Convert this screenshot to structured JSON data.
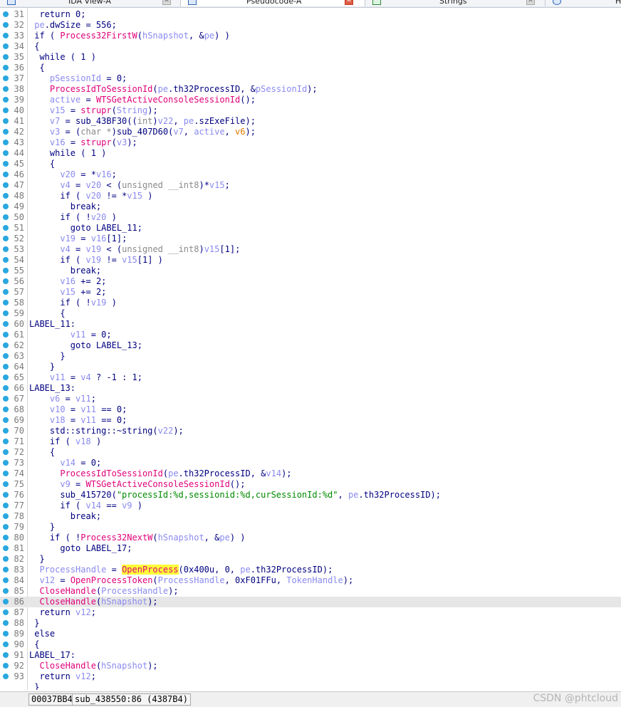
{
  "tabs": [
    {
      "label": "IDA View-A",
      "icon": "ida-view-icon",
      "active": false
    },
    {
      "label": "Pseudocode-A",
      "icon": "pseudocode-icon",
      "active": true
    },
    {
      "label": "Strings",
      "icon": "strings-icon",
      "active": false
    },
    {
      "label": "He",
      "icon": "hex-view-icon",
      "active": false
    }
  ],
  "code_lines": [
    {
      "n": "31",
      "h": "  return 0;"
    },
    {
      "n": "32",
      "h": " <span class=\"v\">pe</span>.dwSize = 556;"
    },
    {
      "n": "33",
      "h": " if ( <span class=\"f\">Process32FirstW</span>(<span class=\"v\">hSnapshot</span>, &amp;<span class=\"v\">pe</span>) )"
    },
    {
      "n": "34",
      "h": " {"
    },
    {
      "n": "35",
      "h": "  while ( 1 )"
    },
    {
      "n": "36",
      "h": "  {"
    },
    {
      "n": "37",
      "h": "    <span class=\"v\">pSessionId</span> = 0;"
    },
    {
      "n": "38",
      "h": "    <span class=\"f\">ProcessIdToSessionId</span>(<span class=\"v\">pe</span>.th32ProcessID, &amp;<span class=\"v\">pSessionId</span>);"
    },
    {
      "n": "39",
      "h": "    <span class=\"v\">active</span> = <span class=\"f\">WTSGetActiveConsoleSessionId</span>();"
    },
    {
      "n": "40",
      "h": "    <span class=\"v\">v15</span> = <span class=\"f\">strupr</span>(<span class=\"v\">String</span>);"
    },
    {
      "n": "41",
      "h": "    <span class=\"v\">v7</span> = sub_43BF30((<span class=\"g\">int</span>)<span class=\"v\">v22</span>, <span class=\"v\">pe</span>.szExeFile);"
    },
    {
      "n": "42",
      "h": "    <span class=\"v\">v3</span> = (<span class=\"g\">char *</span>)sub_407D60(<span class=\"v\">v7</span>, <span class=\"v\">active</span>, <span class=\"o\">v6</span>);"
    },
    {
      "n": "43",
      "h": "    <span class=\"v\">v16</span> = <span class=\"f\">strupr</span>(<span class=\"v\">v3</span>);"
    },
    {
      "n": "44",
      "h": "    while ( 1 )"
    },
    {
      "n": "45",
      "h": "    {"
    },
    {
      "n": "46",
      "h": "      <span class=\"v\">v20</span> = *<span class=\"v\">v16</span>;"
    },
    {
      "n": "47",
      "h": "      <span class=\"v\">v4</span> = <span class=\"v\">v20</span> &lt; (<span class=\"g\">unsigned __int8</span>)*<span class=\"v\">v15</span>;"
    },
    {
      "n": "48",
      "h": "      if ( <span class=\"v\">v20</span> != *<span class=\"v\">v15</span> )"
    },
    {
      "n": "49",
      "h": "        break;"
    },
    {
      "n": "50",
      "h": "      if ( !<span class=\"v\">v20</span> )"
    },
    {
      "n": "51",
      "h": "        goto LABEL_11;"
    },
    {
      "n": "52",
      "h": "      <span class=\"v\">v19</span> = <span class=\"v\">v16</span>[1];"
    },
    {
      "n": "53",
      "h": "      <span class=\"v\">v4</span> = <span class=\"v\">v19</span> &lt; (<span class=\"g\">unsigned __int8</span>)<span class=\"v\">v15</span>[1];"
    },
    {
      "n": "54",
      "h": "      if ( <span class=\"v\">v19</span> != <span class=\"v\">v15</span>[1] )"
    },
    {
      "n": "55",
      "h": "        break;"
    },
    {
      "n": "56",
      "h": "      <span class=\"v\">v16</span> += 2;"
    },
    {
      "n": "57",
      "h": "      <span class=\"v\">v15</span> += 2;"
    },
    {
      "n": "58",
      "h": "      if ( !<span class=\"v\">v19</span> )"
    },
    {
      "n": "59",
      "h": "      {"
    },
    {
      "n": "60",
      "h": "LABEL_11:"
    },
    {
      "n": "61",
      "h": "        <span class=\"v\">v11</span> = 0;"
    },
    {
      "n": "62",
      "h": "        goto LABEL_13;"
    },
    {
      "n": "63",
      "h": "      }"
    },
    {
      "n": "64",
      "h": "    }"
    },
    {
      "n": "65",
      "h": "    <span class=\"v\">v11</span> = <span class=\"v\">v4</span> ? -1 : 1;"
    },
    {
      "n": "66",
      "h": "LABEL_13:"
    },
    {
      "n": "67",
      "h": "    <span class=\"v\">v6</span> = <span class=\"v\">v11</span>;"
    },
    {
      "n": "68",
      "h": "    <span class=\"v\">v10</span> = <span class=\"v\">v11</span> == 0;"
    },
    {
      "n": "69",
      "h": "    <span class=\"v\">v18</span> = <span class=\"v\">v11</span> == 0;"
    },
    {
      "n": "70",
      "h": "    std::string::~string(<span class=\"v\">v22</span>);"
    },
    {
      "n": "71",
      "h": "    if ( <span class=\"v\">v18</span> )"
    },
    {
      "n": "72",
      "h": "    {"
    },
    {
      "n": "73",
      "h": "      <span class=\"v\">v14</span> = 0;"
    },
    {
      "n": "74",
      "h": "      <span class=\"f\">ProcessIdToSessionId</span>(<span class=\"v\">pe</span>.th32ProcessID, &amp;<span class=\"v\">v14</span>);"
    },
    {
      "n": "75",
      "h": "      <span class=\"v\">v9</span> = <span class=\"f\">WTSGetActiveConsoleSessionId</span>();"
    },
    {
      "n": "76",
      "h": "      sub_415720(<span class=\"s\">\"processId:%d,sessionid:%d,curSessionId:%d\"</span>, <span class=\"v\">pe</span>.th32ProcessID);"
    },
    {
      "n": "77",
      "h": "      if ( <span class=\"v\">v14</span> == <span class=\"v\">v9</span> )"
    },
    {
      "n": "78",
      "h": "        break;"
    },
    {
      "n": "79",
      "h": "    }"
    },
    {
      "n": "80",
      "h": "    if ( !<span class=\"f\">Process32NextW</span>(<span class=\"v\">hSnapshot</span>, &amp;<span class=\"v\">pe</span>) )"
    },
    {
      "n": "81",
      "h": "      goto LABEL_17;"
    },
    {
      "n": "82",
      "h": "  }"
    },
    {
      "n": "83",
      "h": "  <span class=\"v\">ProcessHandle</span> = <span class=\"f y\">OpenProcess</span>(0x400u, 0, <span class=\"v\">pe</span>.th32ProcessID);"
    },
    {
      "n": "84",
      "h": "  <span class=\"v\">v12</span> = <span class=\"f\">OpenProcessToken</span>(<span class=\"v\">ProcessHandle</span>, 0xF01FFu, <span class=\"v\">TokenHandle</span>);"
    },
    {
      "n": "85",
      "h": "  <span class=\"f\">CloseHandle</span>(<span class=\"v\">ProcessHandle</span>);"
    },
    {
      "n": "86",
      "h": "  <span class=\"f\">CloseHandle</span>(<span class=\"v\">hSnapshot</span>);",
      "hl": true
    },
    {
      "n": "87",
      "h": "  return <span class=\"v\">v12</span>;"
    },
    {
      "n": "88",
      "h": " }"
    },
    {
      "n": "89",
      "h": " else"
    },
    {
      "n": "90",
      "h": " {"
    },
    {
      "n": "91",
      "h": "LABEL_17:"
    },
    {
      "n": "92",
      "h": "  <span class=\"f\">CloseHandle</span>(<span class=\"v\">hSnapshot</span>);"
    },
    {
      "n": "93",
      "h": "  return <span class=\"v\">v12</span>;"
    },
    {
      "n": "",
      "h": " }"
    }
  ],
  "status": {
    "address": "00037BB4",
    "location": "sub_438550:86 (4387B4)"
  },
  "watermark": "CSDN @phtcloud"
}
